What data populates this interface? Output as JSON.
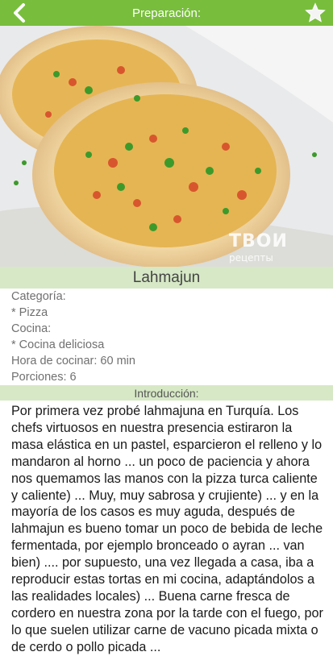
{
  "appbar": {
    "title": "Preparación:",
    "back_icon": "chevron-left-icon",
    "favorite_icon": "star-icon",
    "color": "#78be3c"
  },
  "hero": {
    "watermark_main": "ТВОИ",
    "watermark_sub": "рецепты"
  },
  "recipe": {
    "name": "Lahmajun",
    "category_label": "Categoría:",
    "category_value": "* Pizza",
    "cuisine_label": "Cocina:",
    "cuisine_value": "* Cocina deliciosa",
    "time_line": "Hora de cocinar: 60 min",
    "servings_line": "Porciones: 6"
  },
  "intro": {
    "header": "Introducción:",
    "text": "Por primera vez probé lahmajuna en Turquía. Los chefs virtuosos en nuestra presencia estiraron la masa elástica en un pastel, esparcieron el relleno y lo mandaron al horno ... un poco de paciencia y ahora nos quemamos las manos con la pizza turca caliente y caliente) ... Muy, muy sabrosa y crujiente) ... y en la mayoría de los casos es muy aguda, después de lahmajun es bueno tomar un poco de bebida de leche fermentada, por ejemplo bronceado o ayran ... van bien) .... por supuesto, una vez llegada a casa, iba a reproducir estas tortas en mi cocina, adaptándolos a las realidades locales) ... Buena carne fresca de cordero en nuestra zona por la tarde con el fuego, por lo que suelen utilizar carne de vacuno picada mixta o de cerdo o pollo picada ..."
  }
}
